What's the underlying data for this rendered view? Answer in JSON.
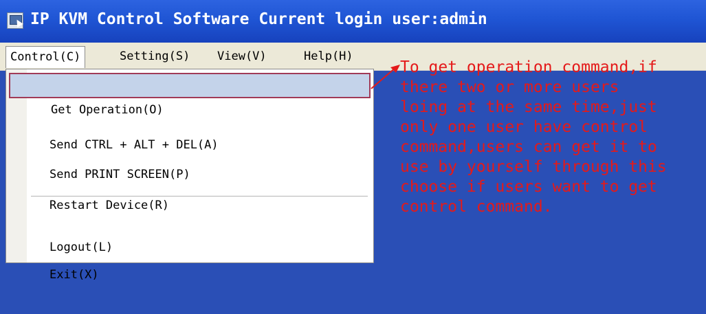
{
  "window": {
    "title": "IP KVM Control Software Current login user:admin",
    "icon": "app-window-icon"
  },
  "menubar": {
    "items": [
      {
        "label": "Control(C)"
      },
      {
        "label": "Setting(S)"
      },
      {
        "label": "View(V)"
      },
      {
        "label": "Help(H)"
      }
    ]
  },
  "dropdown": {
    "items": [
      {
        "label": "Get Operation(O)"
      },
      {
        "label": "Send CTRL + ALT + DEL(A)"
      },
      {
        "label": "Send PRINT SCREEN(P)"
      },
      {
        "label": "Restart Device(R)"
      },
      {
        "label": "Logout(L)"
      },
      {
        "label": "Exit(X)"
      }
    ]
  },
  "annotation": {
    "lines": [
      "To get operation command,if",
      "there two or more users",
      "loing at the same time,just",
      "only one user have control",
      "command,users can get it to",
      "use by yourself through this",
      "choose if users want to get",
      "control command."
    ],
    "color": "#e41a1a"
  },
  "colors": {
    "titlebar": "#1f55d4",
    "background": "#2a4fb6",
    "menubar": "#ece9d8",
    "selection": "#c4d3ea",
    "selection_border": "#a13a57"
  }
}
